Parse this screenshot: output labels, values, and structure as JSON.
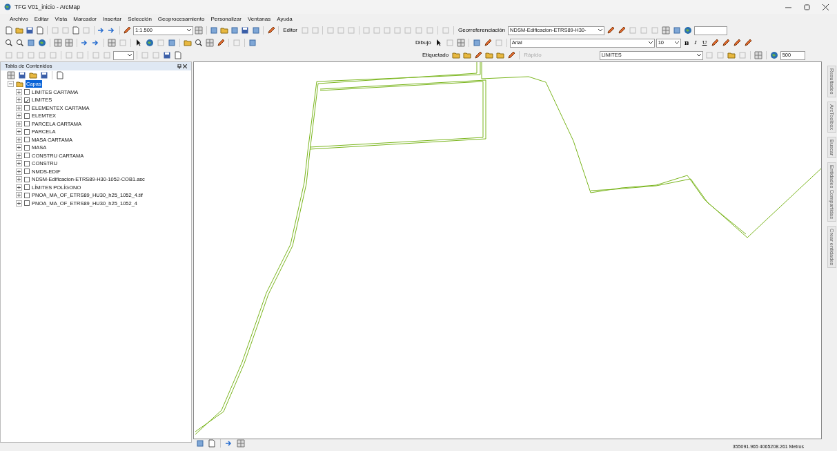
{
  "window": {
    "title": "TFG V01_inicio - ArcMap"
  },
  "menu": [
    "Archivo",
    "Editar",
    "Vista",
    "Marcador",
    "Insertar",
    "Selección",
    "Geoprocesamiento",
    "Personalizar",
    "Ventanas",
    "Ayuda"
  ],
  "toolbars": {
    "scale": "1:1.500",
    "editor": "Editor",
    "georef": "Georreferenciación",
    "georef_layer": "NDSM-Edificacion-ETRS89-H30-",
    "drawing": "Dibujo",
    "font": "Arial",
    "font_size": "10",
    "bold": "B",
    "italic": "I",
    "underline": "U",
    "labeling": "Etiquetado",
    "quick": {
      "label": "Rápido",
      "disabled": true
    },
    "label_layer": "LIMITES",
    "scale_value": "500"
  },
  "toc": {
    "title": "Tabla de Contenidos",
    "root": {
      "label": "Capas",
      "selected": true,
      "expanded": true,
      "children": [
        {
          "label": "LIMITES CARTAMA",
          "checked": false
        },
        {
          "label": "LIMITES",
          "checked": true
        },
        {
          "label": "ELEMENTEX CARTAMA",
          "checked": false
        },
        {
          "label": "ELEMTEX",
          "checked": false
        },
        {
          "label": "PARCELA CARTAMA",
          "checked": false
        },
        {
          "label": "PARCELA",
          "checked": false
        },
        {
          "label": "MASA CARTAMA",
          "checked": false
        },
        {
          "label": "MASA",
          "checked": false
        },
        {
          "label": "CONSTRU CARTAMA",
          "checked": false
        },
        {
          "label": "CONSTRU",
          "checked": false
        },
        {
          "label": "NMDS-EDIF",
          "checked": false
        },
        {
          "label": "NDSM-Edificacion-ETRS89-H30-1052-COB1.asc",
          "checked": false
        },
        {
          "label": "LÍMITES POLÍGONO",
          "checked": false
        },
        {
          "label": "PNOA_MA_OF_ETRS89_HU30_h25_1052_4.tif",
          "checked": false
        },
        {
          "label": "PNOA_MA_OF_ETRS89_HU30_h25_1052_4",
          "checked": false
        }
      ]
    }
  },
  "side_tabs": [
    "Resultados",
    "ArcToolbox",
    "Buscar",
    "Entidades Compartidas",
    "Crear entidades"
  ],
  "status_bar": {
    "coordinates": "355091.965  4065208.261 Metros"
  }
}
